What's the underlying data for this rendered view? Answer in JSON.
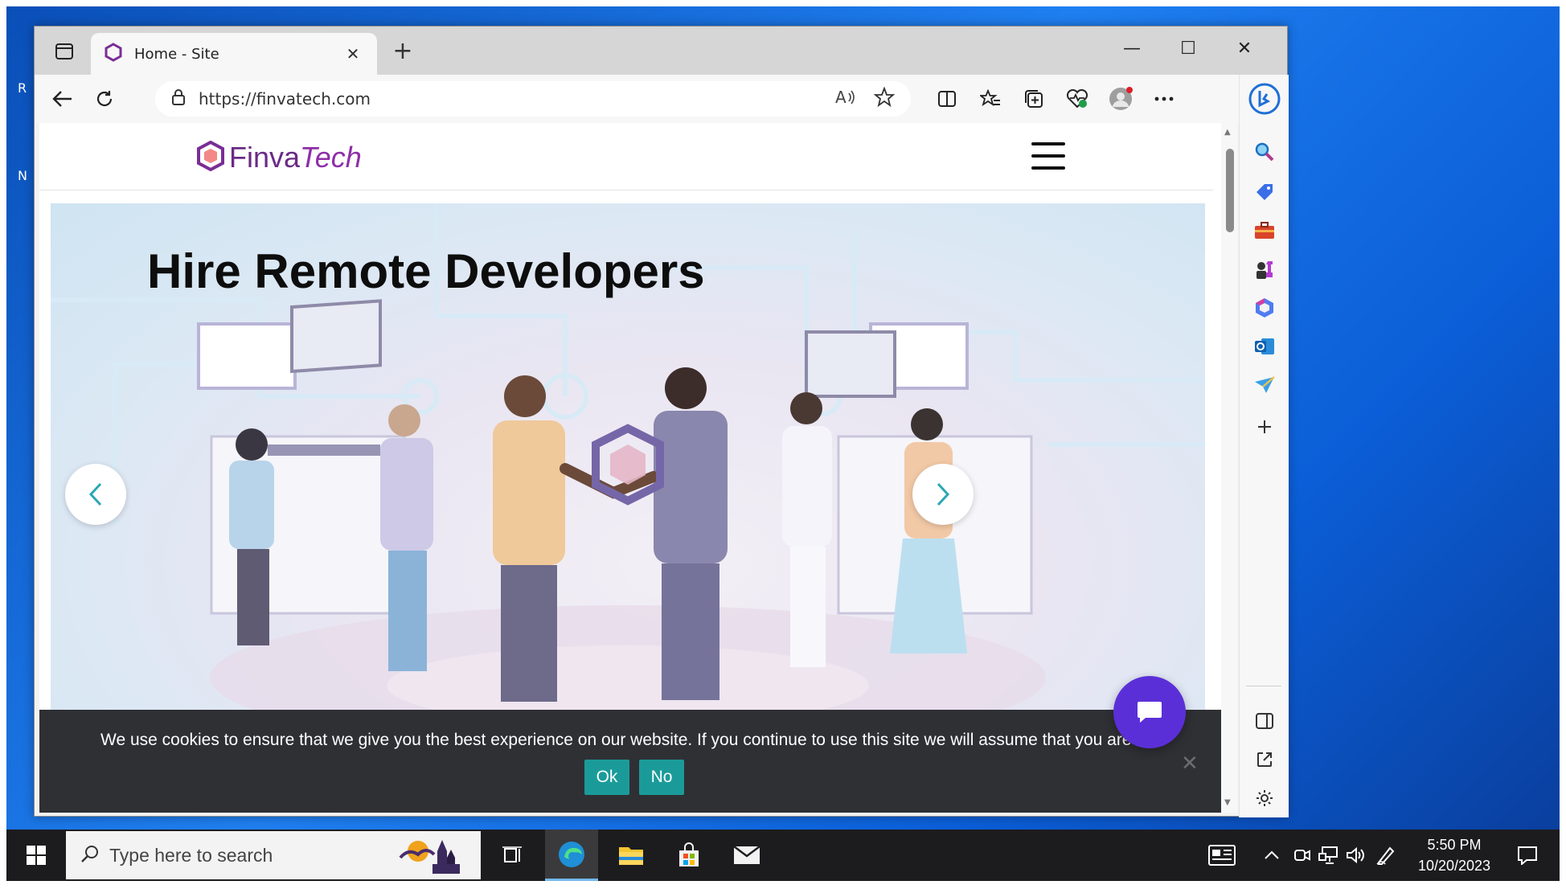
{
  "desktop": {
    "edge_labels": [
      "R",
      "N"
    ]
  },
  "browser": {
    "tab": {
      "title": "Home - Site",
      "close": "✕"
    },
    "new_tab": "+",
    "window_controls": {
      "minimize": "—",
      "maximize": "☐",
      "close": "✕"
    },
    "address": {
      "url": "https://finvatech.com"
    }
  },
  "site": {
    "logo": {
      "part1": "Finva",
      "part2": "Tech"
    },
    "hero": {
      "title": "Hire Remote Developers"
    },
    "cookie": {
      "message": "We use cookies to ensure that we give you the best experience on our website. If you continue to use this site we will assume that you are happy wi",
      "ok_label": "Ok",
      "no_label": "No",
      "close": "✕"
    }
  },
  "taskbar": {
    "search_placeholder": "Type here to search",
    "time": "5:50 PM",
    "date": "10/20/2023"
  },
  "colors": {
    "accent_purple": "#6b2a86",
    "cookie_button": "#1a9b9a",
    "chat_bubble": "#5b2fd8",
    "carousel_arrow": "#2aa7b3"
  }
}
